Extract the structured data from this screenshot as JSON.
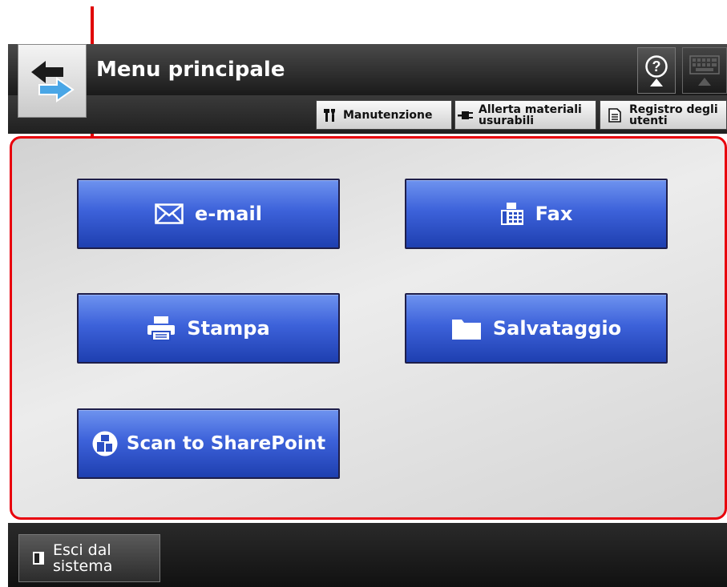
{
  "header": {
    "title": "Menu principale",
    "home_icon": "arrows-swap-icon",
    "help_icon": "question-icon",
    "keyboard_icon": "keyboard-icon"
  },
  "toolbar": {
    "maintenance_label": "Manutenzione",
    "consumables_line1": "Allerta materiali",
    "consumables_line2": "usurabili",
    "user_log_line1": "Registro degli",
    "user_log_line2": "utenti"
  },
  "functions": {
    "email_label": "e-mail",
    "fax_label": "Fax",
    "print_label": "Stampa",
    "save_label": "Salvataggio",
    "sharepoint_label": "Scan to SharePoint"
  },
  "footer": {
    "logout_line1": "Esci dal",
    "logout_line2": "sistema"
  },
  "colors": {
    "accent_red": "#e8000c",
    "button_blue": "#3d62da",
    "header_dark": "#2a2a2a"
  }
}
